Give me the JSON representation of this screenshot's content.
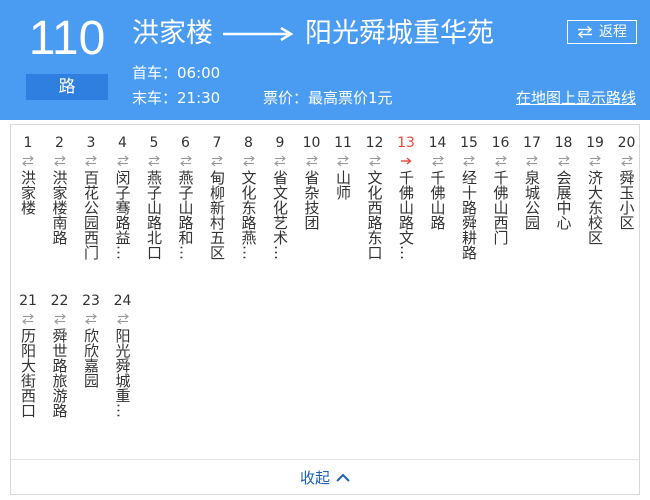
{
  "header": {
    "route_number": "110",
    "route_suffix": "路",
    "origin": "洪家楼",
    "destination": "阳光舜城重华苑",
    "first_bus": "首车：06:00",
    "last_bus": "末车：21:30",
    "fare": "票价：最高票价1元",
    "return_label": "返程",
    "map_link": "在地图上显示路线"
  },
  "stops": [
    {
      "num": "1",
      "name": "洪家楼"
    },
    {
      "num": "2",
      "name": "洪家楼南路"
    },
    {
      "num": "3",
      "name": "百花公园西门"
    },
    {
      "num": "4",
      "name": "闵子骞路益…"
    },
    {
      "num": "5",
      "name": "燕子山路北口"
    },
    {
      "num": "6",
      "name": "燕子山路和…"
    },
    {
      "num": "7",
      "name": "甸柳新村五区"
    },
    {
      "num": "8",
      "name": "文化东路燕…"
    },
    {
      "num": "9",
      "name": "省文化艺术…"
    },
    {
      "num": "10",
      "name": "省杂技团"
    },
    {
      "num": "11",
      "name": "山师"
    },
    {
      "num": "12",
      "name": "文化西路东口"
    },
    {
      "num": "13",
      "name": "千佛山路文…",
      "current": true
    },
    {
      "num": "14",
      "name": "千佛山路"
    },
    {
      "num": "15",
      "name": "经十路舜耕路"
    },
    {
      "num": "16",
      "name": "千佛山西门"
    },
    {
      "num": "17",
      "name": "泉城公园"
    },
    {
      "num": "18",
      "name": "会展中心"
    },
    {
      "num": "19",
      "name": "济大东校区"
    },
    {
      "num": "20",
      "name": "舜玉小区"
    },
    {
      "num": "21",
      "name": "历阳大街西口"
    },
    {
      "num": "22",
      "name": "舜世路旅游路"
    },
    {
      "num": "23",
      "name": "欣欣嘉园"
    },
    {
      "num": "24",
      "name": "阳光舜城重…"
    }
  ],
  "collapse_label": "收起",
  "colors": {
    "header_bg": "#4a9bf2",
    "suffix_bg": "#2f7fe0",
    "current_stop": "#e8473b",
    "link_blue": "#1f5fb8",
    "direction_gray": "#999999"
  },
  "icons": {
    "title_arrow": "long-right-arrow-icon",
    "return": "swap-arrows-icon",
    "direction": "bidirectional-arrows-icon",
    "current_direction": "right-arrow-icon",
    "collapse": "chevron-up-icon"
  }
}
